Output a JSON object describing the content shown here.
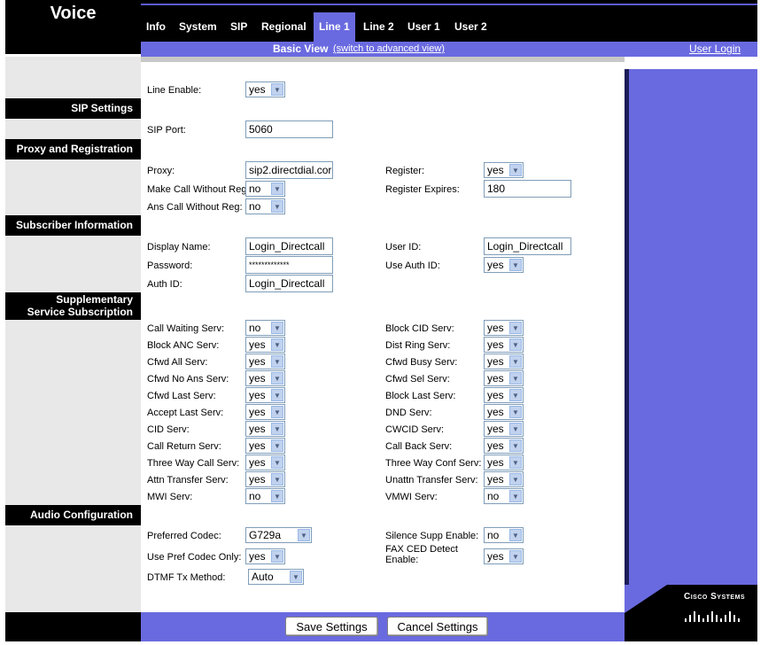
{
  "header": {
    "title": "Voice",
    "tabs": [
      "Info",
      "System",
      "SIP",
      "Regional",
      "Line 1",
      "Line 2",
      "User 1",
      "User 2"
    ],
    "active_tab": "Line 1",
    "view_label": "Basic View",
    "switch_link": "(switch to advanced view)",
    "user_login": "User Login"
  },
  "sections": {
    "sip": "SIP Settings",
    "proxy": "Proxy and Registration",
    "subscriber": "Subscriber Information",
    "supp": "Supplementary Service Subscription",
    "audio": "Audio Configuration"
  },
  "line_enable": {
    "label": "Line Enable:",
    "value": "yes"
  },
  "sip_port": {
    "label": "SIP Port:",
    "value": "5060"
  },
  "proxy": {
    "proxy_label": "Proxy:",
    "proxy_value": "sip2.directdial.cor",
    "register_label": "Register:",
    "register_value": "yes",
    "mcwr_label": "Make Call Without Reg:",
    "mcwr_value": "no",
    "reg_exp_label": "Register Expires:",
    "reg_exp_value": "180",
    "acwr_label": "Ans Call Without Reg:",
    "acwr_value": "no"
  },
  "subscriber": {
    "display_label": "Display Name:",
    "display_value": "Login_Directcall",
    "userid_label": "User ID:",
    "userid_value": "Login_Directcall",
    "password_label": "Password:",
    "password_value": "*************",
    "useauth_label": "Use Auth ID:",
    "useauth_value": "yes",
    "authid_label": "Auth ID:",
    "authid_value": "Login_Directcall"
  },
  "supp_left": [
    {
      "label": "Call Waiting Serv:",
      "value": "no"
    },
    {
      "label": "Block ANC Serv:",
      "value": "yes"
    },
    {
      "label": "Cfwd All Serv:",
      "value": "yes"
    },
    {
      "label": "Cfwd No Ans Serv:",
      "value": "yes"
    },
    {
      "label": "Cfwd Last Serv:",
      "value": "yes"
    },
    {
      "label": "Accept Last Serv:",
      "value": "yes"
    },
    {
      "label": "CID Serv:",
      "value": "yes"
    },
    {
      "label": "Call Return Serv:",
      "value": "yes"
    },
    {
      "label": "Three Way Call Serv:",
      "value": "yes"
    },
    {
      "label": "Attn Transfer Serv:",
      "value": "yes"
    },
    {
      "label": "MWI Serv:",
      "value": "no"
    }
  ],
  "supp_right": [
    {
      "label": "Block CID Serv:",
      "value": "yes"
    },
    {
      "label": "Dist Ring Serv:",
      "value": "yes"
    },
    {
      "label": "Cfwd Busy Serv:",
      "value": "yes"
    },
    {
      "label": "Cfwd Sel Serv:",
      "value": "yes"
    },
    {
      "label": "Block Last Serv:",
      "value": "yes"
    },
    {
      "label": "DND Serv:",
      "value": "yes"
    },
    {
      "label": "CWCID Serv:",
      "value": "yes"
    },
    {
      "label": "Call Back Serv:",
      "value": "yes"
    },
    {
      "label": "Three Way Conf Serv:",
      "value": "yes"
    },
    {
      "label": "Unattn Transfer Serv:",
      "value": "yes"
    },
    {
      "label": "VMWI Serv:",
      "value": "no"
    }
  ],
  "audio": {
    "codec_label": "Preferred Codec:",
    "codec_value": "G729a",
    "silence_label": "Silence Supp Enable:",
    "silence_value": "no",
    "prefonly_label": "Use Pref Codec Only:",
    "prefonly_value": "yes",
    "fax_label": "FAX CED Detect Enable:",
    "fax_value": "yes",
    "dtmf_label": "DTMF Tx Method:",
    "dtmf_value": "Auto"
  },
  "buttons": {
    "save": "Save Settings",
    "cancel": "Cancel Settings"
  },
  "logo": {
    "text": "Cisco Systems"
  },
  "colors": {
    "accent": "#6a6ae0",
    "header": "#000000"
  }
}
